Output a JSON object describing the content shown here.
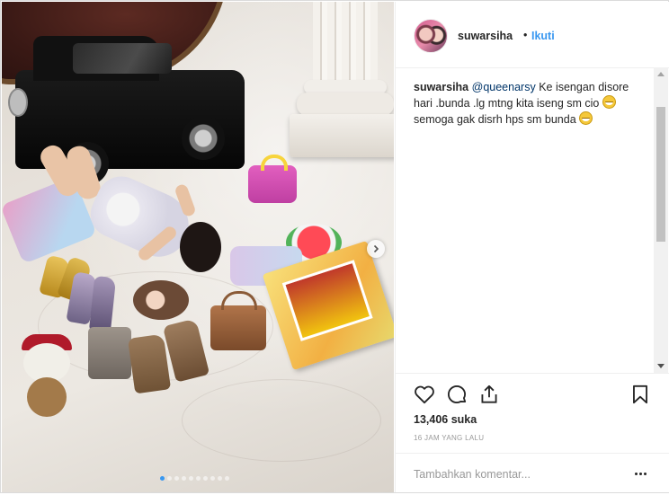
{
  "post": {
    "carousel": {
      "slide_count": 10,
      "active_slide": 1
    }
  },
  "header": {
    "username": "suwarsiha",
    "separator": "•",
    "follow_label": "Ikuti"
  },
  "caption": {
    "username": "suwarsiha",
    "mention": "@queenarsy",
    "text_part1": "Ke isengan disore hari .bunda .lg mtng kita iseng sm cio",
    "text_part2": "semoga gak disrh hps sm bunda"
  },
  "stats": {
    "likes": "13,406 suka",
    "timestamp": "16 JAM YANG LALU"
  },
  "comment_input": {
    "placeholder": "Tambahkan komentar..."
  },
  "icons": {
    "like": "heart-icon",
    "comment": "comment-icon",
    "share": "share-icon",
    "save": "bookmark-icon",
    "next": "chevron-right-icon",
    "options": "more-options-icon"
  },
  "colors": {
    "accent": "#3897f0",
    "mention": "#003569",
    "text": "#262626",
    "muted": "#999999",
    "border": "#efefef"
  }
}
